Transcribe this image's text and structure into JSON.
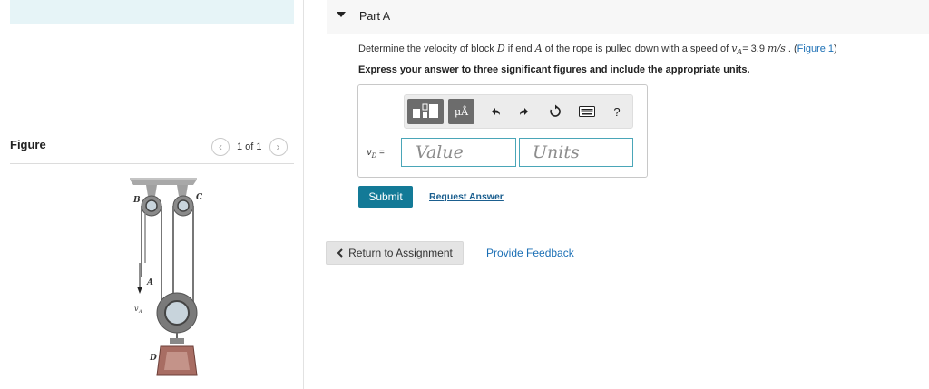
{
  "figure_panel": {
    "title": "Figure",
    "pagination": "1 of 1",
    "prev_icon": "chevron-left-icon",
    "next_icon": "chevron-right-icon",
    "diagram_labels": {
      "b": "B",
      "c": "C",
      "a": "A",
      "v_a": "v",
      "v_a_sub": "A",
      "d": "D"
    }
  },
  "part": {
    "title": "Part A",
    "caret_icon": "caret-down-icon"
  },
  "question": {
    "pre": "Determine the velocity of block ",
    "block": "D",
    "mid": " if end ",
    "end": "A",
    "mid2": " of the rope is pulled down with a speed of ",
    "speed_var": "v",
    "speed_sub": "A",
    "speed_value": "= 3.9 ",
    "speed_unit": "m/s",
    "post": " . (",
    "figure_link": "Figure 1",
    "close": ")"
  },
  "instruction": "Express your answer to three significant figures and include the appropriate units.",
  "toolbar": {
    "templates_icon": "templates-icon",
    "units_label": "μÅ",
    "undo_icon": "undo-icon",
    "redo_icon": "redo-icon",
    "reset_icon": "reset-icon",
    "keyboard_icon": "keyboard-icon",
    "help_label": "?"
  },
  "answer": {
    "var": "v",
    "var_sub": "D",
    "equals": " =",
    "value_placeholder": "Value",
    "units_placeholder": "Units"
  },
  "actions": {
    "submit": "Submit",
    "request_answer": "Request Answer",
    "return": "Return to Assignment",
    "feedback": "Provide Feedback"
  },
  "colors": {
    "accent": "#137a97",
    "link": "#1b6fb5",
    "topbar": "#e6f4f7"
  }
}
